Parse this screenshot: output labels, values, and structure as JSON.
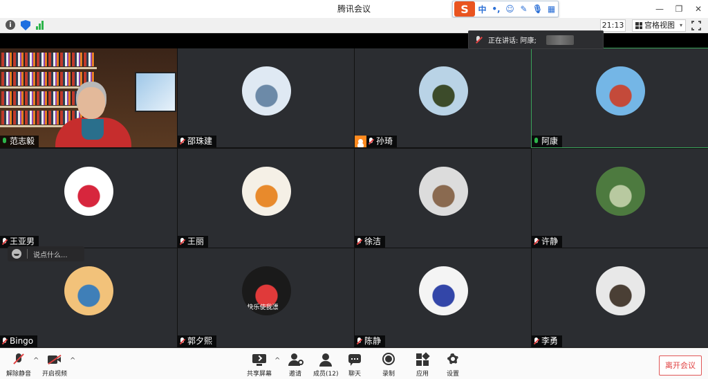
{
  "window": {
    "title": "腾讯会议",
    "minimize_glyph": "—",
    "restore_glyph": "❐",
    "close_glyph": "✕"
  },
  "ime": {
    "logo": "S",
    "items": [
      "中",
      "•,",
      "☺",
      "✎",
      "🎙",
      "▦"
    ]
  },
  "infobar": {
    "info_glyph": "i",
    "timer": "21:13",
    "view_label": "宫格视图",
    "caret": "▾"
  },
  "speaking": {
    "label": "正在讲话: 阿康;"
  },
  "participants": [
    {
      "name": "范志毅",
      "mic": "on",
      "video": true
    },
    {
      "name": "邵珠建",
      "mic": "off",
      "avatar_colors": [
        "#dfe9f3",
        "#6c8aa8"
      ]
    },
    {
      "name": "孙琦",
      "mic": "off",
      "host": true,
      "avatar_colors": [
        "#b9d3e6",
        "#3c4b2a"
      ]
    },
    {
      "name": "阿康",
      "mic": "on",
      "active": true,
      "avatar_colors": [
        "#74b6e6",
        "#c44a3a"
      ]
    },
    {
      "name": "王亚男",
      "mic": "off",
      "avatar_colors": [
        "#ffffff",
        "#d7263d"
      ]
    },
    {
      "name": "王丽",
      "mic": "off",
      "avatar_colors": [
        "#f5f0e6",
        "#e88a2c"
      ]
    },
    {
      "name": "徐洁",
      "mic": "off",
      "avatar_colors": [
        "#dcdcdc",
        "#8a6a50"
      ]
    },
    {
      "name": "许静",
      "mic": "off",
      "avatar_colors": [
        "#4d7a3f",
        "#b8c9a0"
      ]
    },
    {
      "name": "Bingo",
      "mic": "off",
      "avatar_colors": [
        "#f2c27a",
        "#3f7fb8"
      ]
    },
    {
      "name": "郭夕熙",
      "mic": "off",
      "avatar_colors": [
        "#1a1a1a",
        "#e03a3a"
      ]
    },
    {
      "name": "陈静",
      "mic": "off",
      "avatar_colors": [
        "#f4f4f4",
        "#3346a8"
      ]
    },
    {
      "name": "李勇",
      "mic": "off",
      "avatar_colors": [
        "#e8e8e8",
        "#4a3f35"
      ]
    }
  ],
  "avatar_text": {
    "kumamon_caption": "快乐使我漂"
  },
  "chat_input": {
    "placeholder": "说点什么..."
  },
  "toolbar": {
    "unmute": "解除静音",
    "start_video": "开启视频",
    "share_screen": "共享屏幕",
    "invite": "邀请",
    "members": "成员(12)",
    "chat": "聊天",
    "record": "录制",
    "apps": "应用",
    "settings": "设置",
    "leave": "离开会议",
    "caret": "^"
  }
}
